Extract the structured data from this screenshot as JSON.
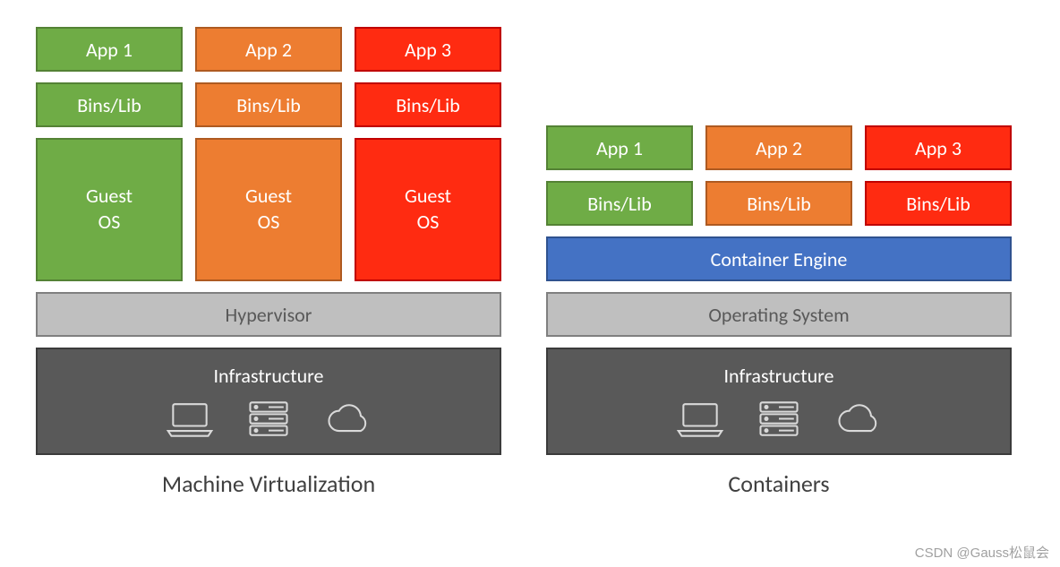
{
  "vm": {
    "apps": [
      "App 1",
      "App 2",
      "App 3"
    ],
    "bins": [
      "Bins/Lib",
      "Bins/Lib",
      "Bins/Lib"
    ],
    "guests": [
      "Guest OS",
      "Guest OS",
      "Guest OS"
    ],
    "hypervisor": "Hypervisor",
    "infrastructure": "Infrastructure",
    "caption": "Machine Virtualization"
  },
  "ct": {
    "apps": [
      "App 1",
      "App 2",
      "App 3"
    ],
    "bins": [
      "Bins/Lib",
      "Bins/Lib",
      "Bins/Lib"
    ],
    "engine": "Container Engine",
    "os": "Operating System",
    "infrastructure": "Infrastructure",
    "caption": "Containers"
  },
  "colors": {
    "green": "#6fac46",
    "orange": "#ed7d31",
    "red": "#ff2b11",
    "blue": "#4472c4",
    "grey": "#bfbfbf",
    "dark": "#595959"
  },
  "watermark": "CSDN @Gauss松鼠会"
}
